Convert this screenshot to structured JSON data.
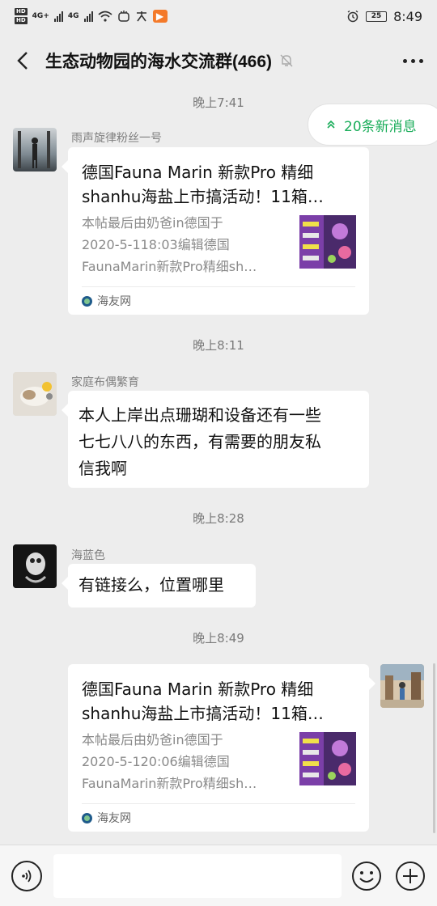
{
  "status_bar": {
    "hd1": "HD",
    "hd2": "HD",
    "net1": "4G+",
    "net2": "4G",
    "battery": "25",
    "time": "8:49"
  },
  "header": {
    "title": "生态动物园的海水交流群(466)"
  },
  "new_messages": {
    "label": "20条新消息"
  },
  "messages": [
    {
      "timestamp": "晚上7:41",
      "sender": "雨声旋律粉丝一号",
      "type": "link",
      "title_line1": "德国Fauna Marin 新款Pro 精细",
      "title_line2": "shanhu海盐上市搞活动！11箱…",
      "desc_line1": "本帖最后由奶爸in德国于",
      "desc_line2": "2020-5-118:03编辑德国",
      "desc_line3": "FaunaMarin新款Pro精细sh…",
      "source": "海友网"
    },
    {
      "timestamp": "晚上8:11",
      "sender": "家庭布偶繁育",
      "type": "text",
      "line1": "本人上岸出点珊瑚和设备还有一些",
      "line2": "七七八八的东西，有需要的朋友私",
      "line3": "信我啊"
    },
    {
      "timestamp": "晚上8:28",
      "sender": "海蓝色",
      "type": "text",
      "line1": "有链接么，位置哪里"
    },
    {
      "timestamp": "晚上8:49",
      "sender": "",
      "type": "link",
      "title_line1": "德国Fauna Marin 新款Pro 精细",
      "title_line2": "shanhu海盐上市搞活动！11箱…",
      "desc_line1": "本帖最后由奶爸in德国于",
      "desc_line2": "2020-5-120:06编辑德国",
      "desc_line3": "FaunaMarin新款Pro精细sh…",
      "source": "海友网"
    }
  ],
  "colors": {
    "accent_green": "#1aad5a",
    "background": "#ededed"
  }
}
